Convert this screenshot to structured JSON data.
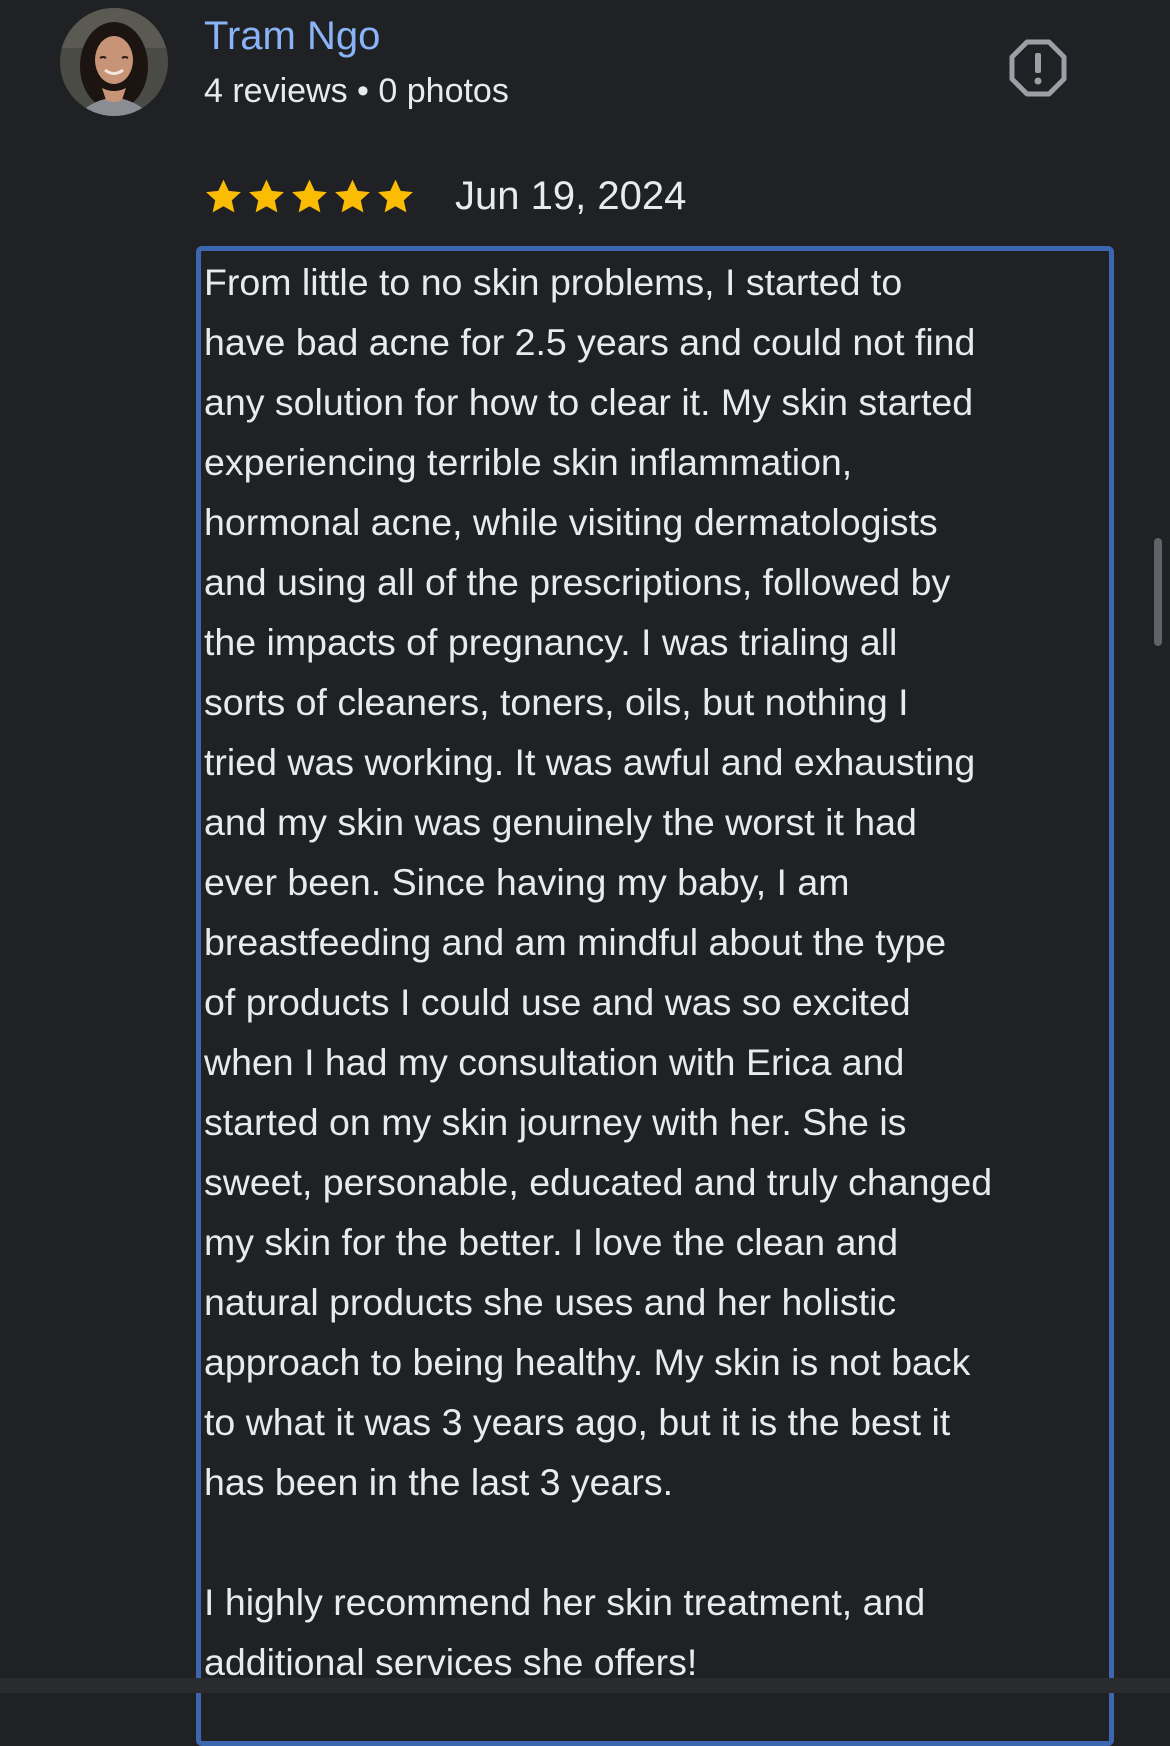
{
  "review": {
    "author": {
      "name": "Tram Ngo",
      "meta": "4 reviews • 0 photos"
    },
    "rating": 5,
    "rating_max": 5,
    "date": "Jun 19, 2024",
    "text_lines": [
      "From little to no skin problems, I started to",
      "have bad acne for 2.5 years and could not find",
      "any solution for how to clear it. My skin started",
      "experiencing terrible skin inflammation,",
      "hormonal acne, while visiting dermatologists",
      "and using all of the prescriptions, followed by",
      "the impacts of pregnancy. I was trialing all",
      "sorts of cleaners, toners, oils, but nothing I",
      "tried was working. It was awful and exhausting",
      "and my skin was genuinely the worst it had",
      "ever been. Since having my baby, I am",
      "breastfeeding and am mindful about the type",
      "of products I could use and was so excited",
      "when I had my consultation with Erica and",
      "started on my skin journey with her. She is",
      "sweet, personable, educated and truly changed",
      "my skin for the better. I love the clean and",
      "natural products she uses and her holistic",
      "approach to being healthy. My skin is not back",
      "to what it was 3 years ago, but it is the best it",
      "has been in the last 3 years.",
      "",
      "I highly recommend her skin treatment, and",
      "additional services she offers!"
    ]
  },
  "icons": {
    "report": "report-flag-icon",
    "star": "star-icon"
  },
  "colors": {
    "background": "#202124",
    "author_name": "#8ab4f8",
    "text": "#e8eaed",
    "star": "#fbbc04",
    "selection_border": "#3c66b0",
    "report_icon": "#9aa0a6"
  }
}
